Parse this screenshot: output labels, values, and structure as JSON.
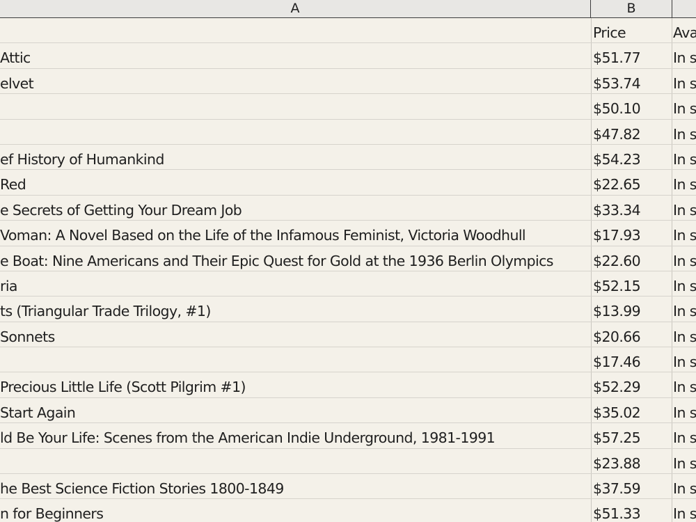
{
  "columns": {
    "a": "A",
    "b": "B",
    "c": ""
  },
  "header_row": {
    "title": "",
    "price": "Price",
    "availability": "Ava"
  },
  "rows": [
    {
      "title": "Attic",
      "price": "$51.77",
      "availability": "In s"
    },
    {
      "title": "elvet",
      "price": "$53.74",
      "availability": "In s"
    },
    {
      "title": "",
      "price": "$50.10",
      "availability": "In s"
    },
    {
      "title": "",
      "price": "$47.82",
      "availability": "In s"
    },
    {
      "title": "ef History of Humankind",
      "price": "$54.23",
      "availability": "In s"
    },
    {
      "title": "Red",
      "price": "$22.65",
      "availability": "In s"
    },
    {
      "title": "e Secrets of Getting Your Dream Job",
      "price": "$33.34",
      "availability": "In s"
    },
    {
      "title": "Voman: A Novel Based on the Life of the Infamous Feminist, Victoria Woodhull",
      "price": "$17.93",
      "availability": "In s"
    },
    {
      "title": "e Boat: Nine Americans and Their Epic Quest for Gold at the 1936 Berlin Olympics",
      "price": "$22.60",
      "availability": "In s"
    },
    {
      "title": "ria",
      "price": "$52.15",
      "availability": "In s"
    },
    {
      "title": "ts (Triangular Trade Trilogy, #1)",
      "price": "$13.99",
      "availability": "In s"
    },
    {
      "title": "Sonnets",
      "price": "$20.66",
      "availability": "In s"
    },
    {
      "title": "",
      "price": "$17.46",
      "availability": "In s"
    },
    {
      "title": "Precious Little Life (Scott Pilgrim #1)",
      "price": "$52.29",
      "availability": "In s"
    },
    {
      "title": "Start Again",
      "price": "$35.02",
      "availability": "In s"
    },
    {
      "title": "ld Be Your Life: Scenes from the American Indie Underground, 1981-1991",
      "price": "$57.25",
      "availability": "In s"
    },
    {
      "title": "",
      "price": "$23.88",
      "availability": "In s"
    },
    {
      "title": "he Best Science Fiction Stories 1800-1849",
      "price": "$37.59",
      "availability": "In s"
    },
    {
      "title": "n for Beginners",
      "price": "$51.33",
      "availability": "In s"
    }
  ]
}
